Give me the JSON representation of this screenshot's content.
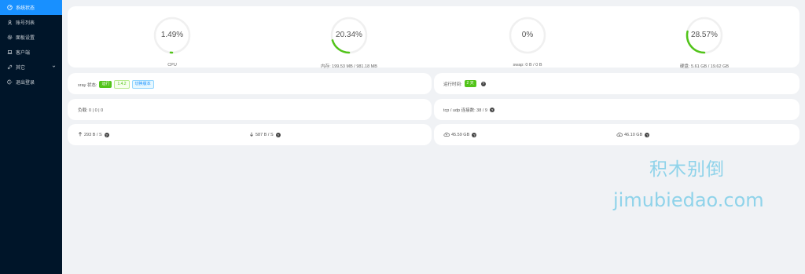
{
  "sidebar": {
    "items": [
      {
        "label": "系统状态",
        "icon": "dashboard-icon",
        "active": true
      },
      {
        "label": "账号列表",
        "icon": "user-icon",
        "active": false
      },
      {
        "label": "面板设置",
        "icon": "settings-icon",
        "active": false
      },
      {
        "label": "客户端",
        "icon": "laptop-icon",
        "active": false
      },
      {
        "label": "其它",
        "icon": "link-icon",
        "active": false,
        "has_submenu": true
      },
      {
        "label": "退出登录",
        "icon": "logout-icon",
        "active": false
      }
    ]
  },
  "gauges": [
    {
      "value": "1.49%",
      "percent": 1.49,
      "label": "CPU"
    },
    {
      "value": "20.34%",
      "percent": 20.34,
      "label": "内存: 199.53 MB / 981.18 MB"
    },
    {
      "value": "0%",
      "percent": 0,
      "label": "swap: 0 B / 0 B"
    },
    {
      "value": "28.57%",
      "percent": 28.57,
      "label": "硬盘: 5.61 GB / 19.62 GB"
    }
  ],
  "colors": {
    "gauge": "#52c41a",
    "track": "#f0f0f0",
    "accent": "#1890ff",
    "sidebar": "#001529"
  },
  "xray": {
    "label": "xray 状态:",
    "status": "运行",
    "version": "1.4.2",
    "switch": "切换版本"
  },
  "uptime": {
    "label": "运行时间:",
    "value": "2 天"
  },
  "load": {
    "text": "负载: 0 | 0 | 0"
  },
  "connections": {
    "text": "tcp / udp 连接数: 38 / 9"
  },
  "network_speed": {
    "up": "293 B / S",
    "down": "587 B / S"
  },
  "traffic": {
    "up": "45.59 GB",
    "down": "46.10 GB"
  },
  "watermark": {
    "cn": "积木别倒",
    "url": "jimubiedao.com"
  }
}
